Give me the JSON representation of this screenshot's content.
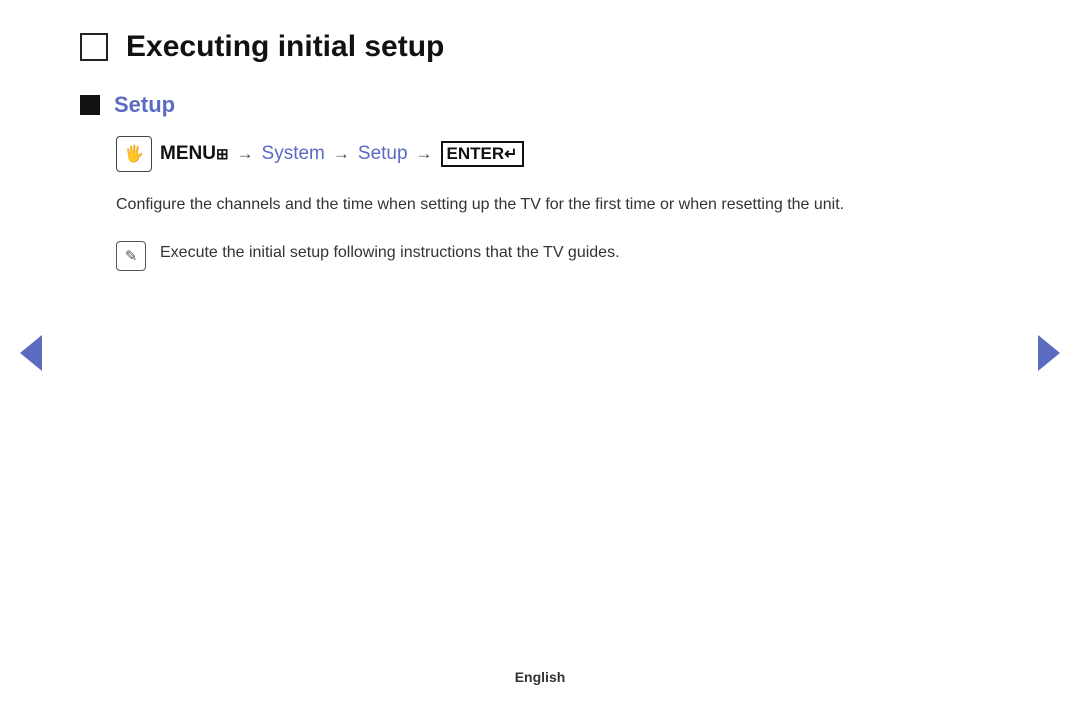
{
  "page": {
    "title": "Executing initial setup",
    "section": {
      "label": "Setup",
      "menu_path": {
        "menu_icon_symbol": "🖐",
        "menu_label": "MENU",
        "menu_suffix": "⊞",
        "arrow1": "→",
        "link1": "System",
        "arrow2": "→",
        "link2": "Setup",
        "arrow3": "→",
        "enter_label": "ENTER",
        "enter_symbol": "↵"
      },
      "description": "Configure the channels and the time when setting up the TV for the first time or when resetting the unit.",
      "note": "Execute the initial setup following instructions that the TV guides."
    },
    "footer": "English",
    "nav_left_label": "previous",
    "nav_right_label": "next"
  }
}
